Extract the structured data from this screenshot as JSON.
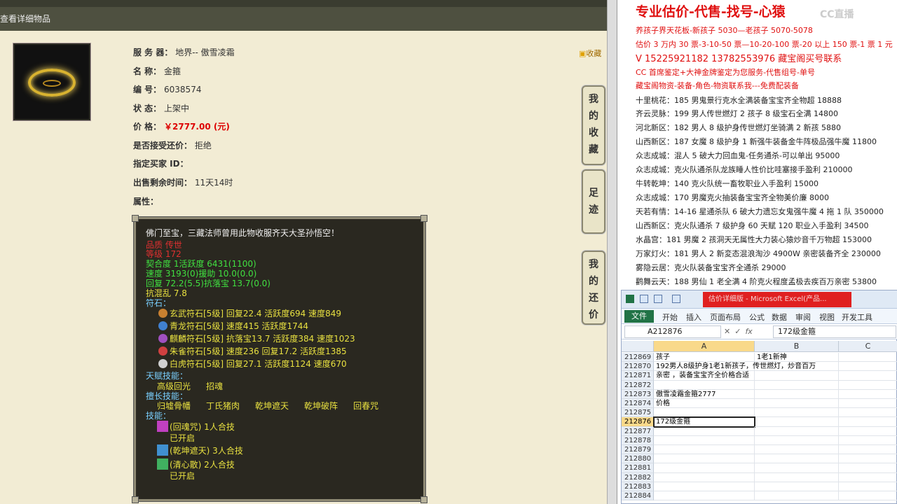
{
  "game": {
    "title": "查看详细物品",
    "favorite_label": "收藏",
    "info": [
      {
        "label": "服 务 器：",
        "value": "地界-- 傲雪凌霜"
      },
      {
        "label": "名        称：",
        "value": "金箍"
      },
      {
        "label": "编        号：",
        "value": "6038574"
      },
      {
        "label": "状        态：",
        "value": "上架中"
      },
      {
        "label": "价        格：",
        "value": "￥2777.00 (元)"
      },
      {
        "label": "是否接受还价：",
        "value": "拒绝"
      },
      {
        "label": "指定买家 ID：",
        "value": ""
      },
      {
        "label": "出售剩余时间：",
        "value": "11天14时"
      },
      {
        "label": "属性：",
        "value": ""
      }
    ],
    "side_tabs": [
      "我的收藏",
      "足迹",
      "我的还价"
    ],
    "tooltip": {
      "desc": "佛门至宝，三藏法师曾用此物收服齐天大圣孙悟空！",
      "quality": "品质  传世",
      "level": "等级  172",
      "stats": [
        "契合度      1活跃度  6431(1100)",
        "速度     3193(0)援助     10.0(0.0)",
        "回复     72.2(5.5)抗落宝     13.7(0.0)"
      ],
      "stat_extra": "抗混乱 7.8",
      "runes_title": "符石：",
      "runes": [
        {
          "text": "玄武符石[5级] 回复22.4 活跃度694 速度849",
          "color": "#c88030"
        },
        {
          "text": "青龙符石[5级] 速度415 活跃度1744",
          "color": "#4080d0"
        },
        {
          "text": "麒麟符石[5级] 抗落宝13.7 活跃度384 速度1023",
          "color": "#a050c0"
        },
        {
          "text": "朱雀符石[5级] 速度236 回复17.2 活跃度1385",
          "color": "#d04040"
        },
        {
          "text": "白虎符石[5级] 回复27.1 活跃度1124 速度670",
          "color": "#d0d0d0"
        }
      ],
      "talent_title": "天赋技能：",
      "talents": [
        "高级回光",
        "招魂"
      ],
      "specialty_title": "擅长技能：",
      "specialties": [
        "归墟骨幡",
        "丁氏猪肉",
        "乾坤遮天",
        "乾坤破阵",
        "回春咒"
      ],
      "skills_title": "技能：",
      "skills": [
        {
          "name": "(回魂咒) 1人合技",
          "status": "已开启"
        },
        {
          "name": "(乾坤遮天) 3人合技",
          "status": ""
        },
        {
          "name": "(清心散) 2人合技",
          "status": "已开启"
        }
      ]
    }
  },
  "ad": {
    "headline": "专业估价-代售-找号-心猿",
    "cc_logo": "CC直播",
    "lines_red": [
      "养孩子界天花板-新孩子 5030—老孩子 5070-5078",
      "估价 3 万内 30 票-3-10-50 票—10-20-100 票-20 以上 150 票-1 票 1 元",
      "V 15225921182      13782553976    藏宝阁买号联系",
      "CC 首席鉴定+大神金牌鉴定为您服务-代售组号-单号",
      "藏宝阁物资-装备-角色-物资联系我---免费配装备"
    ],
    "listings": [
      "十里桃花：185 男鬼景行克水全满装备宝宝齐全物超 18888",
      "齐云灵脉：199 男人传世燃灯 2 孩子 8 级宝石全满 14800",
      "河北新区：182 男人 8 级护身传世燃灯坐骑满 2 新孩 5880",
      "山西新区：187 女魔 8 级护身 1 新强牛装备金牛阵极品强牛魔 11800",
      "众志成城：混人 5 破大力回血鬼-任务通杀-可以单出 95000",
      "众志成城：克火队通杀队龙族睡人性价比哇塞接手盈利 210000",
      "牛转乾坤：140 克火队统一畜牧职业入手盈利 15000",
      "众志成城：170 男魔克火抽装备宝宝齐全物美价廉 8000",
      "天若有情：14-16 星通杀队 6 破大力遗忘女鬼强牛魔 4 拖 1 队 350000",
      "山西新区：克火队通杀 7 级护身 60 天赋 120 职业入手盈利 34500",
      "水晶宫：181 男魔 2 孩洞天无属性大力装心猿炒音千万物超 153000",
      "万家灯火：181 男人 2 新変态混浪淘沙 4900W 亲密装备齐全 230000",
      "雾隐云居：克火队装备宝宝齐全通杀 29000",
      "鹳舞云天：188 男仙 1 老全满 4 阶克火程度孟极去疾百万亲密 53800"
    ]
  },
  "excel": {
    "title": "估价详细版 - Microsoft Excel(产品...",
    "ribbon_file": "文件",
    "ribbon_tabs": [
      "开始",
      "插入",
      "页面布局",
      "公式",
      "数据",
      "审阅",
      "视图",
      "开发工具"
    ],
    "name_box": "A212876",
    "formula": "172级金箍",
    "fx": "fx",
    "columns": [
      "A",
      "B",
      "C"
    ],
    "rows": [
      {
        "num": "212869",
        "a": "孩子",
        "b": "1老1新神"
      },
      {
        "num": "212870",
        "a": "192男人8级护身1老1新孩子，传世燃灯，炒音百万",
        "b": ""
      },
      {
        "num": "212871",
        "a": "亲密 ，装备宝宝齐全价格合适",
        "b": ""
      },
      {
        "num": "212872",
        "a": "",
        "b": ""
      },
      {
        "num": "212873",
        "a": "傲雪凌霜金箍2777",
        "b": ""
      },
      {
        "num": "212874",
        "a": "价格",
        "b": ""
      },
      {
        "num": "212875",
        "a": "",
        "b": ""
      },
      {
        "num": "212876",
        "a": "172级金箍",
        "b": ""
      },
      {
        "num": "212877",
        "a": "",
        "b": ""
      },
      {
        "num": "212878",
        "a": "",
        "b": ""
      },
      {
        "num": "212879",
        "a": "",
        "b": ""
      },
      {
        "num": "212880",
        "a": "",
        "b": ""
      },
      {
        "num": "212881",
        "a": "",
        "b": ""
      },
      {
        "num": "212882",
        "a": "",
        "b": ""
      },
      {
        "num": "212883",
        "a": "",
        "b": ""
      },
      {
        "num": "212884",
        "a": "",
        "b": ""
      }
    ]
  }
}
